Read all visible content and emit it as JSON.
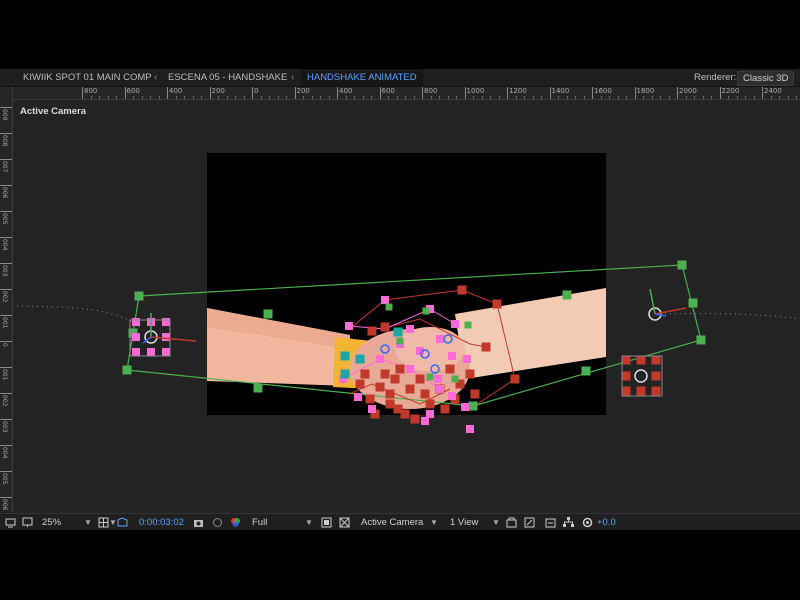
{
  "tabs": [
    {
      "label": "KIWIIK SPOT 01 MAIN COMP"
    },
    {
      "label": "ESCENA 05 - HANDSHAKE"
    },
    {
      "label": "HANDSHAKE ANIMATED"
    }
  ],
  "renderer": {
    "label": "Renderer:",
    "value": "Classic 3D"
  },
  "ruler_ticks": [
    "800",
    "600",
    "400",
    "200",
    "0",
    "200",
    "400",
    "600",
    "800",
    "1000",
    "1200",
    "1400",
    "1600",
    "1800",
    "2000",
    "2200",
    "2400",
    "2600"
  ],
  "vruler_ticks": [
    "009",
    "008",
    "007",
    "006",
    "005",
    "004",
    "003",
    "002",
    "001",
    "0",
    "001",
    "002",
    "003",
    "004",
    "005",
    "006"
  ],
  "viewer": {
    "label": "Active Camera"
  },
  "toolbar": {
    "zoom": "25%",
    "timecode": "0:00:03:02",
    "resolution": "Full",
    "view": "Active Camera",
    "layout": "1 View",
    "exposure": "+0.0"
  },
  "colors": {
    "accent": "#5aa2ff",
    "handle_green": "#4caf50",
    "handle_pink": "#ff6ad5",
    "handle_red": "#c0392b",
    "handle_teal": "#1aa7a7",
    "arm_skin": "#f2cbb5"
  },
  "icons": [
    "snapshot-icon",
    "color-channel-icon",
    "region-icon",
    "transparency-grid-icon",
    "3d-view-icon",
    "fast-preview-icon",
    "draft-icon",
    "flowchart-icon",
    "exposure-reset-icon",
    "magnification-icon",
    "grid-icon",
    "mask-icon"
  ]
}
